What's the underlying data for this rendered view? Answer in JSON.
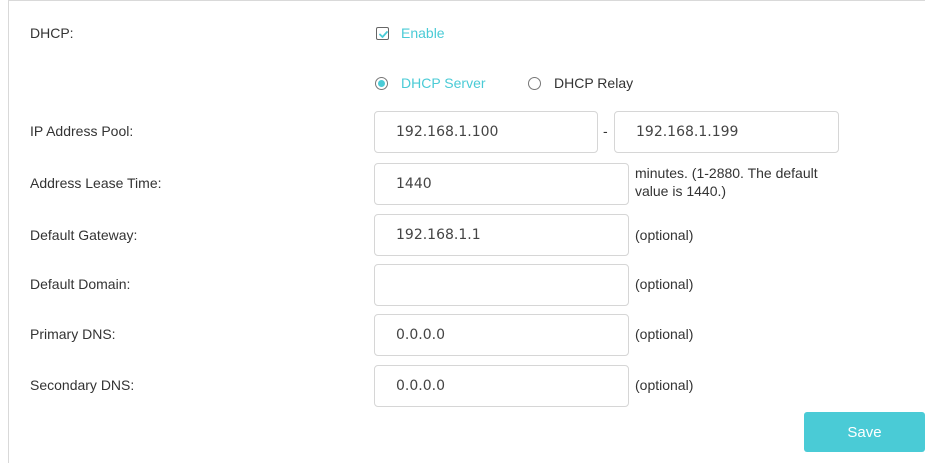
{
  "dhcp": {
    "label": "DHCP:",
    "enable_label": "Enable",
    "enabled": true
  },
  "mode": {
    "server_label": "DHCP Server",
    "relay_label": "DHCP Relay",
    "selected": "DHCP Server"
  },
  "pool": {
    "label": "IP Address Pool:",
    "start": "192.168.1.100",
    "separator": "-",
    "end": "192.168.1.199"
  },
  "lease": {
    "label": "Address Lease Time:",
    "value": "1440",
    "hint_line1": "minutes. (1-2880. The default",
    "hint_line2": "value is 1440.)"
  },
  "gateway": {
    "label": "Default Gateway:",
    "value": "192.168.1.1",
    "hint": "(optional)"
  },
  "domain": {
    "label": "Default Domain:",
    "value": "",
    "hint": "(optional)"
  },
  "primary_dns": {
    "label": "Primary DNS:",
    "value": "0.0.0.0",
    "hint": "(optional)"
  },
  "secondary_dns": {
    "label": "Secondary DNS:",
    "value": "0.0.0.0",
    "hint": "(optional)"
  },
  "save_label": "Save",
  "colors": {
    "accent": "#4acbd6",
    "text": "#333333",
    "border": "#d6d6d6"
  }
}
